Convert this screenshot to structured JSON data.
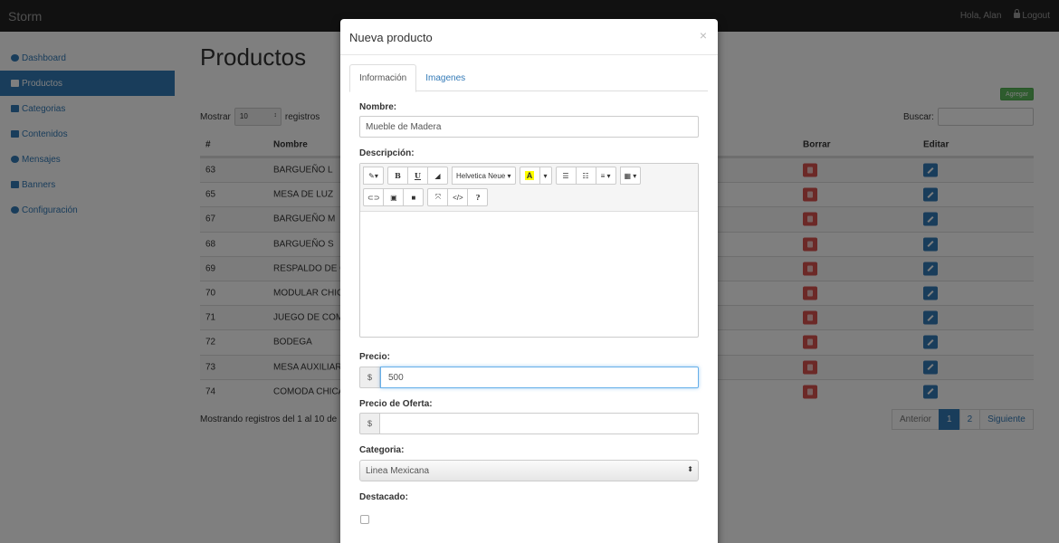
{
  "navbar": {
    "brand": "Storm",
    "greeting": "Hola, Alan",
    "logout": "Logout"
  },
  "sidebar": {
    "items": [
      {
        "label": "Dashboard",
        "icon": "dashboard-icon"
      },
      {
        "label": "Productos",
        "icon": "tag-icon",
        "active": true
      },
      {
        "label": "Categorias",
        "icon": "folder-icon"
      },
      {
        "label": "Contenidos",
        "icon": "file-icon"
      },
      {
        "label": "Mensajes",
        "icon": "comment-icon"
      },
      {
        "label": "Banners",
        "icon": "flag-icon"
      },
      {
        "label": "Configuración",
        "icon": "gear-icon"
      }
    ]
  },
  "page": {
    "title": "Productos",
    "add_button": "Agregar",
    "show_label": "Mostrar",
    "show_value": "10",
    "records_label": "registros",
    "search_label": "Buscar:",
    "table": {
      "headers": {
        "id": "#",
        "name": "Nombre",
        "delete": "Borrar",
        "edit": "Editar"
      },
      "rows": [
        {
          "id": "63",
          "name": "BARGUEÑO L"
        },
        {
          "id": "65",
          "name": "MESA DE LUZ"
        },
        {
          "id": "67",
          "name": "BARGUEÑO M"
        },
        {
          "id": "68",
          "name": "BARGUEÑO S"
        },
        {
          "id": "69",
          "name": "RESPALDO DE C"
        },
        {
          "id": "70",
          "name": "MODULAR CHIC"
        },
        {
          "id": "71",
          "name": "JUEGO DE COM"
        },
        {
          "id": "72",
          "name": "BODEGA"
        },
        {
          "id": "73",
          "name": "MESA AUXILIAR"
        },
        {
          "id": "74",
          "name": "COMODA CHICA"
        }
      ]
    },
    "footer_info": "Mostrando registros del 1 al 10 de",
    "pagination": {
      "prev": "Anterior",
      "pages": [
        "1",
        "2"
      ],
      "next": "Siguiente",
      "current": "1"
    }
  },
  "modal": {
    "title": "Nueva producto",
    "close": "×",
    "tabs": [
      {
        "label": "Información",
        "active": true
      },
      {
        "label": "Imagenes"
      }
    ],
    "fields": {
      "name_label": "Nombre:",
      "name_value": "Mueble de Madera",
      "description_label": "Descripción:",
      "price_label": "Precio:",
      "price_currency": "$",
      "price_value": "500",
      "offer_label": "Precio de Oferta:",
      "offer_currency": "$",
      "offer_value": "",
      "category_label": "Categoria:",
      "category_value": "Linea Mexicana",
      "featured_label": "Destacado:"
    },
    "editor_toolbar": {
      "font_name": "Helvetica Neue",
      "bold": "B",
      "underline": "U",
      "color_letter": "A",
      "help": "?",
      "code": "</>"
    }
  },
  "colors": {
    "primary": "#337ab7",
    "success": "#5cb85c",
    "danger": "#d9534f",
    "navbar": "#222222"
  }
}
